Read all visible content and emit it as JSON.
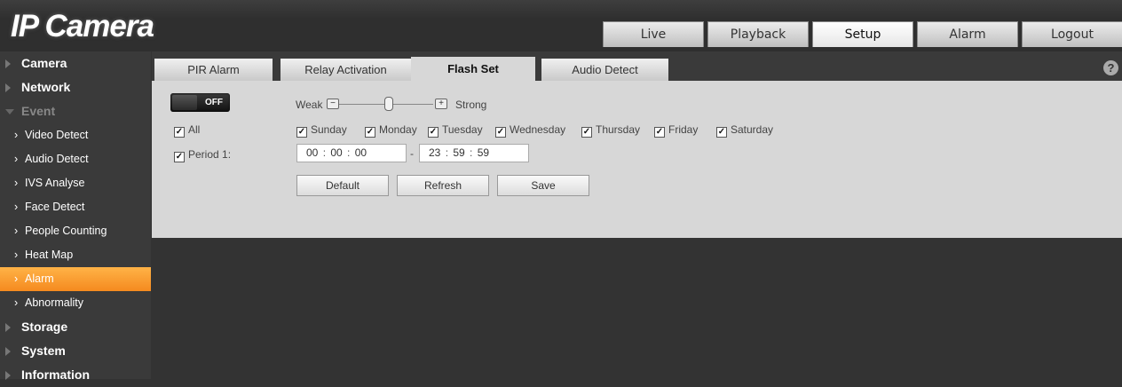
{
  "app": {
    "title": "IP Camera"
  },
  "topnav": [
    "Live",
    "Playback",
    "Setup",
    "Alarm",
    "Logout"
  ],
  "topnav_active": "Setup",
  "sidebar": {
    "items": [
      {
        "label": "Camera",
        "type": "category"
      },
      {
        "label": "Network",
        "type": "category"
      },
      {
        "label": "Event",
        "type": "category-open"
      },
      {
        "label": "Video Detect",
        "type": "sub"
      },
      {
        "label": "Audio Detect",
        "type": "sub"
      },
      {
        "label": "IVS Analyse",
        "type": "sub"
      },
      {
        "label": "Face Detect",
        "type": "sub"
      },
      {
        "label": "People Counting",
        "type": "sub"
      },
      {
        "label": "Heat Map",
        "type": "sub"
      },
      {
        "label": "Alarm",
        "type": "sub-active"
      },
      {
        "label": "Abnormality",
        "type": "sub"
      },
      {
        "label": "Storage",
        "type": "category"
      },
      {
        "label": "System",
        "type": "category"
      },
      {
        "label": "Information",
        "type": "category"
      }
    ]
  },
  "tabs": [
    "PIR Alarm",
    "Relay Activation",
    "Flash Set",
    "Audio Detect"
  ],
  "active_tab": "Flash Set",
  "help": {
    "glyph": "?"
  },
  "flash": {
    "toggle_label": "OFF",
    "weak_label": "Weak",
    "strong_label": "Strong",
    "minus_glyph": "−",
    "plus_glyph": "+",
    "all_label": "All",
    "days": [
      "Sunday",
      "Monday",
      "Tuesday",
      "Wednesday",
      "Thursday",
      "Friday",
      "Saturday"
    ],
    "period_label": "Period 1:",
    "start": [
      "00",
      "00",
      "00"
    ],
    "end": [
      "23",
      "59",
      "59"
    ],
    "time_sep": ":",
    "range_sep": "-",
    "check_glyph": "✓"
  },
  "buttons": {
    "default": "Default",
    "refresh": "Refresh",
    "save": "Save"
  },
  "colors": {
    "active_orange": "#f58a1f",
    "panel_gray": "#d7d7d7",
    "dark_bg": "#333333"
  }
}
